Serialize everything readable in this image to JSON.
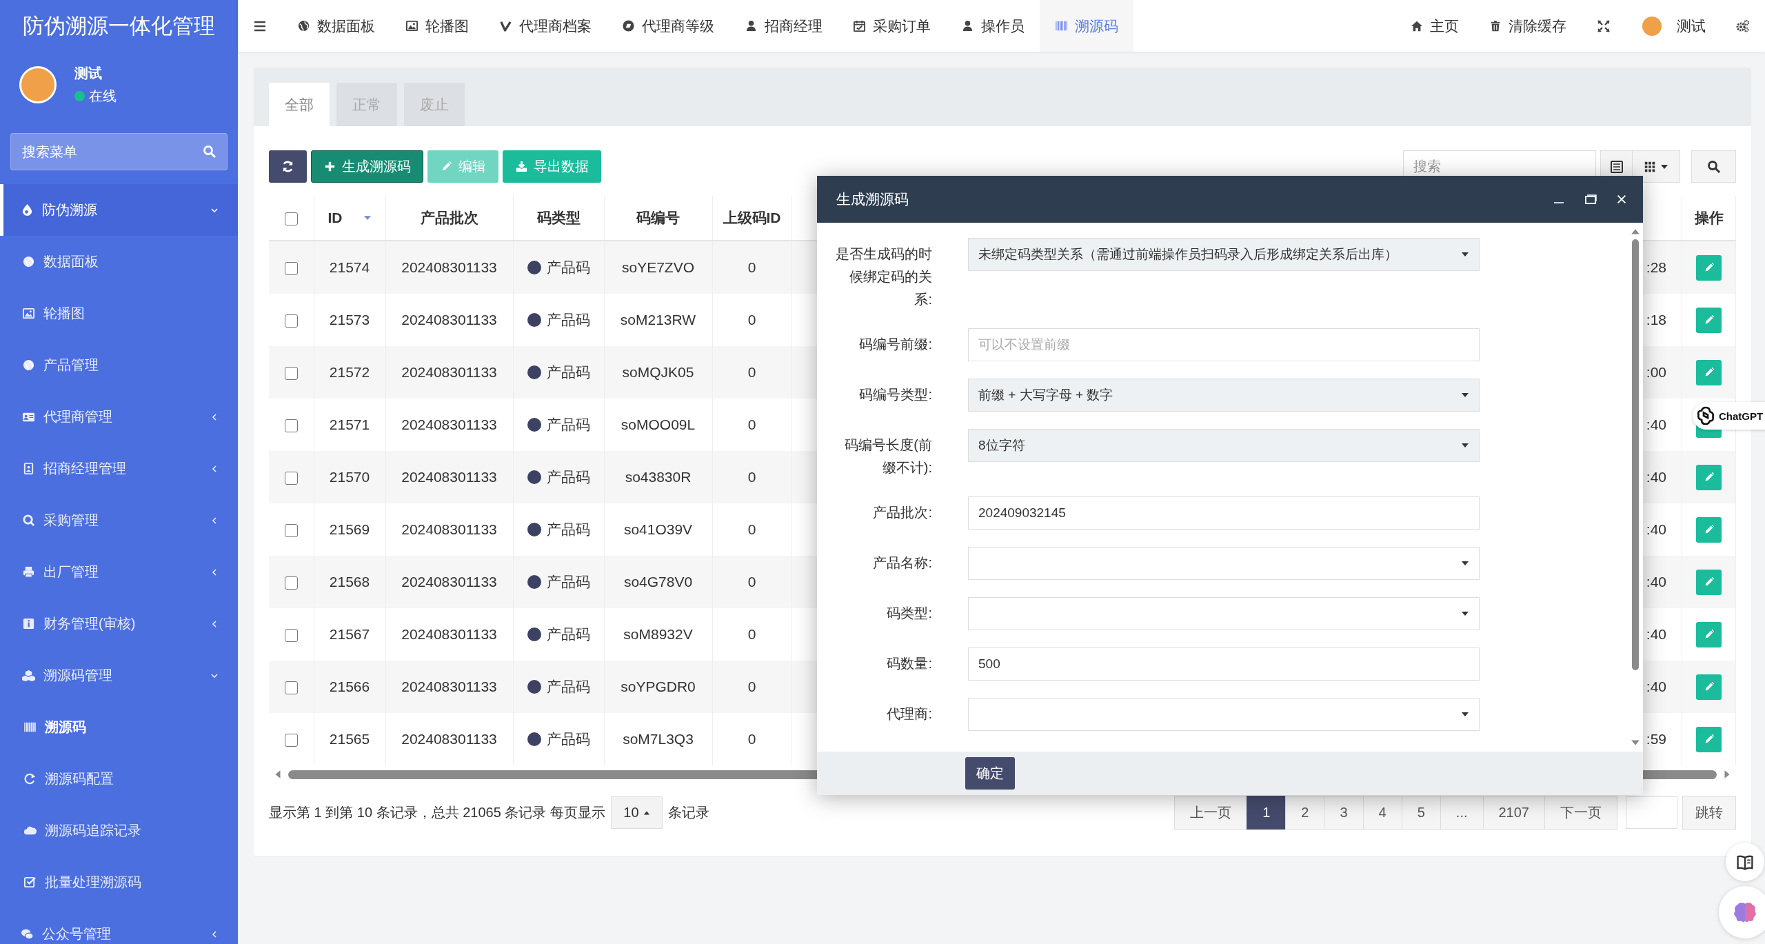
{
  "sidebar": {
    "title": "防伪溯源一体化管理",
    "user": {
      "name": "测试",
      "status": "在线",
      "online": true
    },
    "search": {
      "placeholder": "搜索菜单"
    },
    "items": [
      {
        "label": "防伪溯源",
        "selected": false,
        "expanded": true,
        "children": [
          {
            "label": "数据面板",
            "selected": false
          },
          {
            "label": "轮播图",
            "selected": false
          },
          {
            "label": "产品管理",
            "selected": false
          },
          {
            "label": "代理商管理",
            "selected": false,
            "expanded": false
          },
          {
            "label": "招商经理管理",
            "selected": false,
            "expanded": false
          },
          {
            "label": "采购管理",
            "selected": false,
            "expanded": false
          },
          {
            "label": "出厂管理",
            "selected": false,
            "expanded": false
          },
          {
            "label": "财务管理(审核)",
            "selected": false,
            "expanded": false
          },
          {
            "label": "溯源码管理",
            "selected": false,
            "expanded": true,
            "children": [
              {
                "label": "溯源码",
                "selected": true
              },
              {
                "label": "溯源码配置",
                "selected": false
              },
              {
                "label": "溯源码追踪记录",
                "selected": false
              },
              {
                "label": "批量处理溯源码",
                "selected": false
              }
            ]
          }
        ]
      },
      {
        "label": "公众号管理",
        "selected": false,
        "expanded": false
      }
    ]
  },
  "topnav": {
    "items": [
      {
        "label": "数据面板",
        "selected": false
      },
      {
        "label": "轮播图",
        "selected": false
      },
      {
        "label": "代理商档案",
        "selected": false
      },
      {
        "label": "代理商等级",
        "selected": false
      },
      {
        "label": "招商经理",
        "selected": false
      },
      {
        "label": "采购订单",
        "selected": false
      },
      {
        "label": "操作员",
        "selected": false
      },
      {
        "label": "溯源码",
        "selected": true
      }
    ],
    "right": [
      {
        "kind": "link",
        "label": "主页"
      },
      {
        "kind": "link",
        "label": "清除缓存"
      },
      {
        "kind": "icon"
      },
      {
        "kind": "user",
        "label": "测试"
      },
      {
        "kind": "icon"
      }
    ]
  },
  "tabs": [
    {
      "label": "全部",
      "selected": true
    },
    {
      "label": "正常",
      "selected": false
    },
    {
      "label": "废止",
      "selected": false
    }
  ],
  "toolbar": {
    "buttons": [
      {
        "kind": "refresh",
        "disabled": false
      },
      {
        "kind": "add",
        "label": "生成溯源码",
        "disabled": false
      },
      {
        "kind": "edit",
        "label": "编辑",
        "disabled": true
      },
      {
        "kind": "export",
        "label": "导出数据",
        "disabled": false
      }
    ],
    "search": {
      "placeholder": "搜索"
    }
  },
  "table": {
    "select_all_checked": false,
    "columns": [
      {
        "label": "ID",
        "sorted": true
      },
      {
        "label": "产品批次",
        "sorted": false
      },
      {
        "label": "码类型",
        "sorted": false
      },
      {
        "label": "码编号",
        "sorted": false
      },
      {
        "label": "上级码ID",
        "sorted": false
      },
      {
        "label": "操作",
        "sorted": false
      }
    ],
    "rows": [
      {
        "checked": false,
        "id": "21574",
        "batch": "202408301133",
        "code_type": "产品码",
        "code": "soYE7ZVO",
        "parent_id": "0",
        "column_7": ":28"
      },
      {
        "checked": false,
        "id": "21573",
        "batch": "202408301133",
        "code_type": "产品码",
        "code": "soM213RW",
        "parent_id": "0",
        "column_7": ":18"
      },
      {
        "checked": false,
        "id": "21572",
        "batch": "202408301133",
        "code_type": "产品码",
        "code": "soMQJK05",
        "parent_id": "0",
        "column_7": ":00"
      },
      {
        "checked": false,
        "id": "21571",
        "batch": "202408301133",
        "code_type": "产品码",
        "code": "soMOO09L",
        "parent_id": "0",
        "column_7": ":40"
      },
      {
        "checked": false,
        "id": "21570",
        "batch": "202408301133",
        "code_type": "产品码",
        "code": "so43830R",
        "parent_id": "0",
        "column_7": ":40"
      },
      {
        "checked": false,
        "id": "21569",
        "batch": "202408301133",
        "code_type": "产品码",
        "code": "so41O39V",
        "parent_id": "0",
        "column_7": ":40"
      },
      {
        "checked": false,
        "id": "21568",
        "batch": "202408301133",
        "code_type": "产品码",
        "code": "so4G78V0",
        "parent_id": "0",
        "column_7": ":40"
      },
      {
        "checked": false,
        "id": "21567",
        "batch": "202408301133",
        "code_type": "产品码",
        "code": "soM8932V",
        "parent_id": "0",
        "column_7": ":40"
      },
      {
        "checked": false,
        "id": "21566",
        "batch": "202408301133",
        "code_type": "产品码",
        "code": "soYPGDR0",
        "parent_id": "0",
        "column_7": ":40"
      },
      {
        "checked": false,
        "id": "21565",
        "batch": "202408301133",
        "code_type": "产品码",
        "code": "soM7L3Q3",
        "parent_id": "0",
        "column_7": ":59"
      }
    ]
  },
  "footer": {
    "info": "显示第 1 到第 10 条记录，总共 21065 条记录 每页显示",
    "page_size": "10",
    "info_suffix": "条记录",
    "pages": [
      {
        "label": "上一页",
        "selected": false
      },
      {
        "label": "1",
        "selected": true
      },
      {
        "label": "2",
        "selected": false
      },
      {
        "label": "3",
        "selected": false
      },
      {
        "label": "4",
        "selected": false
      },
      {
        "label": "5",
        "selected": false
      },
      {
        "label": "...",
        "selected": false
      },
      {
        "label": "2107",
        "selected": false
      },
      {
        "label": "下一页",
        "selected": false
      }
    ],
    "jump_button": "跳转"
  },
  "modal": {
    "title": "生成溯源码",
    "submit": "确定",
    "fields": [
      {
        "kind": "select",
        "label": "是否生成码的时候绑定码的关系:",
        "value": "未绑定码类型关系（需通过前端操作员扫码录入后形成绑定关系后出库）",
        "disabled": true
      },
      {
        "kind": "input",
        "label": "码编号前缀:",
        "placeholder": "可以不设置前缀"
      },
      {
        "kind": "select",
        "label": "码编号类型:",
        "value": "前缀 + 大写字母 + 数字",
        "disabled": true
      },
      {
        "kind": "select",
        "label": "码编号长度(前缀不计):",
        "value": "8位字符",
        "disabled": true
      },
      {
        "kind": "input",
        "label": "产品批次:",
        "value": "202409032145"
      },
      {
        "kind": "select",
        "label": "产品名称:",
        "disabled": false
      },
      {
        "kind": "select",
        "label": "码类型:",
        "disabled": false
      },
      {
        "kind": "input",
        "label": "码数量:",
        "value": "500"
      },
      {
        "kind": "select",
        "label": "代理商:",
        "disabled": false
      }
    ]
  },
  "widgets": {
    "assistant_label": "ChatGPT"
  }
}
